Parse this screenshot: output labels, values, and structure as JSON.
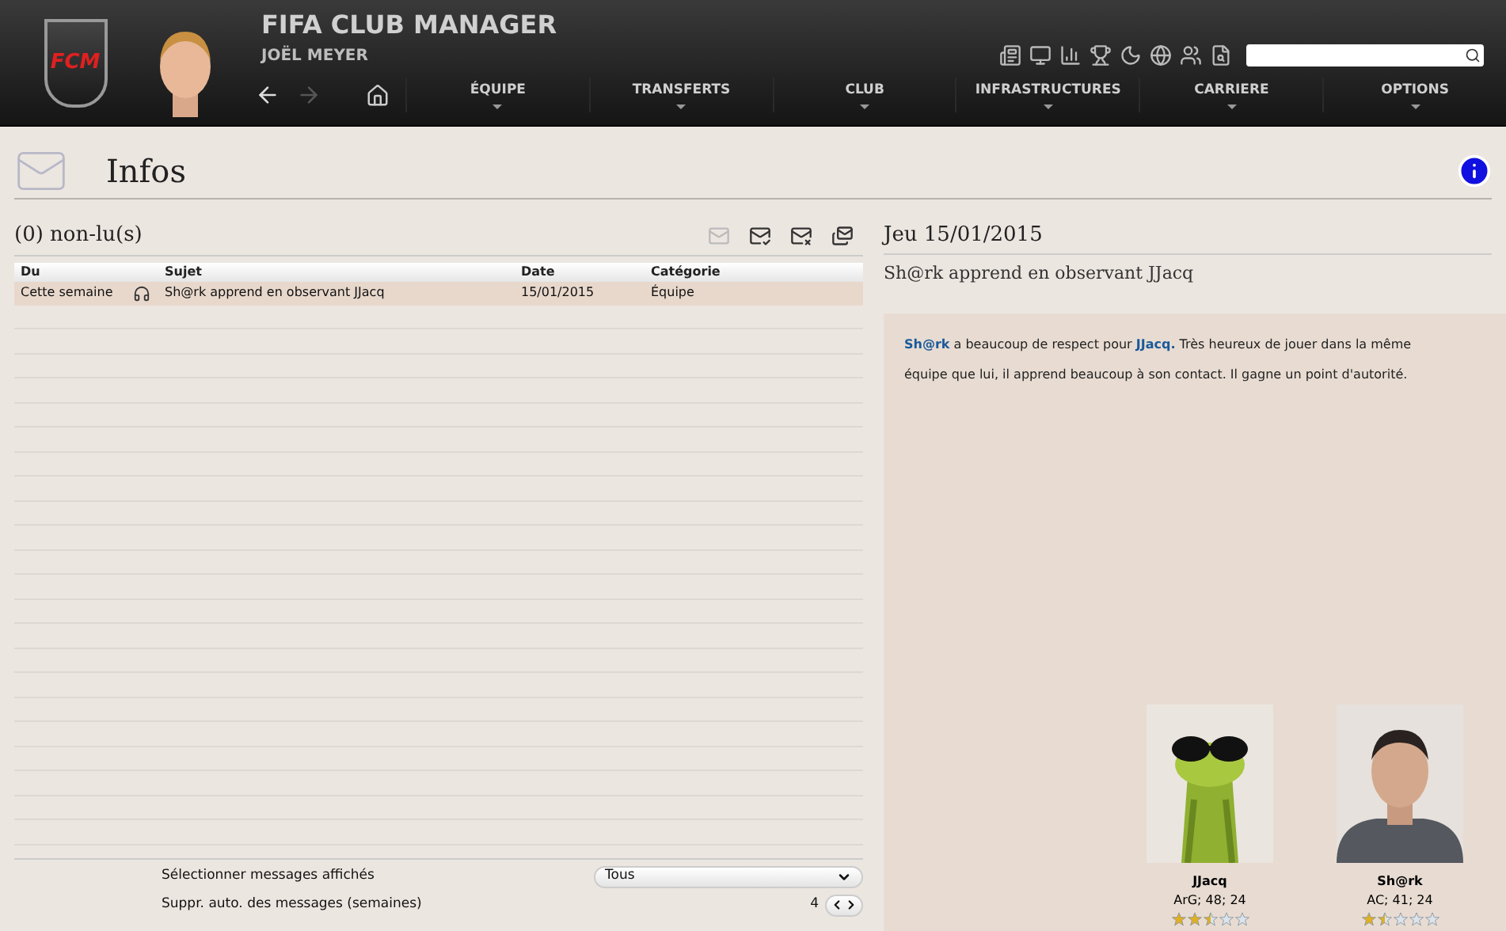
{
  "header": {
    "title": "FIFA CLUB MANAGER",
    "manager": "JOËL MEYER",
    "logo": "FCM",
    "nav": [
      {
        "label": "ÉQUIPE"
      },
      {
        "label": "TRANSFERTS"
      },
      {
        "label": "CLUB"
      },
      {
        "label": "INFRASTRUCTURES"
      },
      {
        "label": "CARRIERE"
      },
      {
        "label": "OPTIONS"
      }
    ]
  },
  "page": {
    "title": "Infos"
  },
  "inbox": {
    "unread": "(0) non-lu(s)",
    "columns": [
      "Du",
      "Sujet",
      "Date",
      "Catégorie"
    ],
    "rows": [
      {
        "from": "Cette semaine",
        "subject": "Sh@rk apprend en observant JJacq",
        "date": "15/01/2015",
        "category": "Équipe",
        "selected": true
      }
    ],
    "filter_label": "Sélectionner messages affichés",
    "filter_value": "Tous",
    "delete_label": "Suppr. auto. des messages (semaines)",
    "delete_value": "4"
  },
  "message": {
    "date": "Jeu 15/01/2015",
    "subject": "Sh@rk apprend en observant JJacq",
    "body": "**Sh@rk** a beaucoup de respect pour **JJacq.** Très heureux de jouer dans la même équipe que lui, il apprend beaucoup à son contact. Il gagne un point d'autorité.",
    "players": [
      {
        "name": "JJacq",
        "info": "ArG; 48; 24",
        "stars": 2.5
      },
      {
        "name": "Sh@rk",
        "info": "AC; 41; 24",
        "stars": 1.5
      }
    ]
  }
}
